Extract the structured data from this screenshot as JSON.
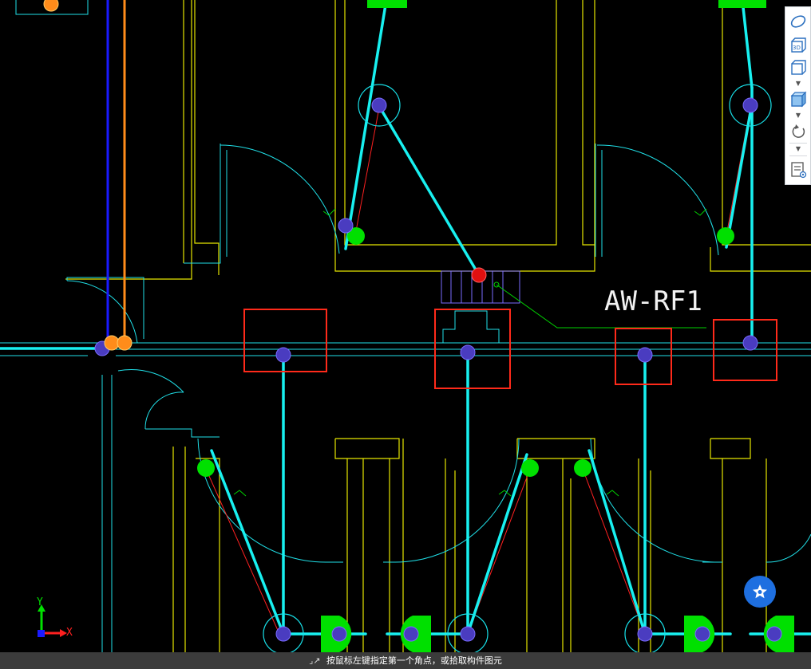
{
  "drawing": {
    "tag_label": "AW-RF1"
  },
  "ucs": {
    "x_label": "X",
    "y_label": "Y"
  },
  "view_toolbar": {
    "buttons": [
      {
        "icon": "orbit-icon"
      },
      {
        "icon": "view-3d-icon",
        "badge": "3D"
      },
      {
        "icon": "view-cube-icon"
      },
      {
        "icon": "shaded-cube-icon"
      },
      {
        "icon": "rotate-icon"
      },
      {
        "icon": "layer-properties-icon"
      }
    ]
  },
  "status": {
    "prompt": "按鼠标左键指定第一个角点，或拾取构件图元"
  },
  "colors": {
    "background": "#000000",
    "wall": "#e6e600",
    "pipe": "#00e5ee",
    "selection": "#ff2a1a",
    "fixture": "#00e000",
    "vertical_blue": "#1a1aff",
    "vertical_orange": "#ff8c1a",
    "accent": "#1e6fe0"
  }
}
